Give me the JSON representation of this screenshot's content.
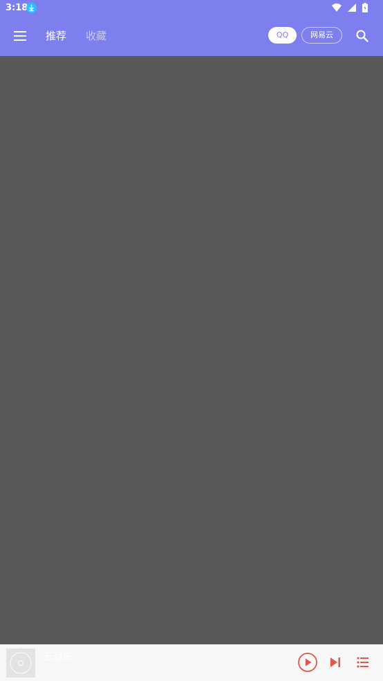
{
  "status_bar": {
    "time": "3:18"
  },
  "toolbar": {
    "tabs": [
      {
        "label": "推荐",
        "active": true
      },
      {
        "label": "收藏",
        "active": false
      }
    ],
    "sources": [
      {
        "label": "QQ",
        "selected": true
      },
      {
        "label": "网易云",
        "selected": false
      }
    ]
  },
  "player": {
    "title": "云音乐"
  },
  "colors": {
    "primary": "#7d7fee",
    "accent": "#e2574c",
    "content_bg": "#595959",
    "player_bg": "#f7f7f7"
  },
  "icons": [
    "menu-icon",
    "search-icon",
    "play-icon",
    "skip-next-icon",
    "playlist-icon",
    "disc-icon",
    "download-icon",
    "wifi-icon",
    "signal-icon",
    "battery-icon"
  ]
}
